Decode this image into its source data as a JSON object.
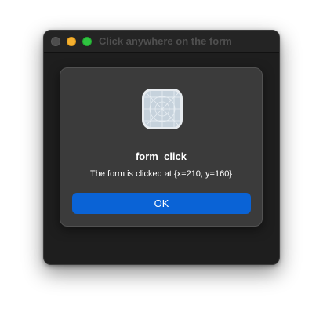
{
  "window": {
    "title": "Click anywhere on the form"
  },
  "dialog": {
    "icon": "generic-app-icon",
    "title": "form_click",
    "message": "The form is clicked at {x=210, y=160}",
    "ok_label": "OK"
  },
  "colors": {
    "accent_button": "#0a63d6",
    "window_background": "#1e1e1e",
    "dialog_background": "#3b3b3b",
    "traffic_minimize": "#f5b02f",
    "traffic_zoom": "#2fc440",
    "traffic_close_inactive": "#4d4d4d"
  }
}
